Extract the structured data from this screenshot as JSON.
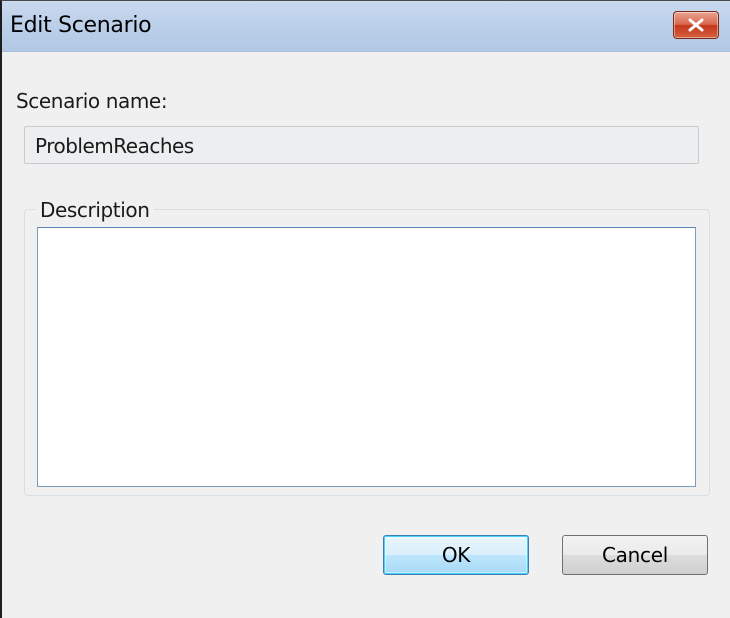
{
  "window": {
    "title": "Edit Scenario",
    "close_icon": "close-icon"
  },
  "form": {
    "name_label": "Scenario name:",
    "name_value": "ProblemReaches",
    "description_legend": "Description",
    "description_value": ""
  },
  "buttons": {
    "ok_label": "OK",
    "cancel_label": "Cancel"
  },
  "colors": {
    "close_button": "#c4381b",
    "default_button_border": "#3c7fb1",
    "dialog_background": "#f0f0f0"
  }
}
